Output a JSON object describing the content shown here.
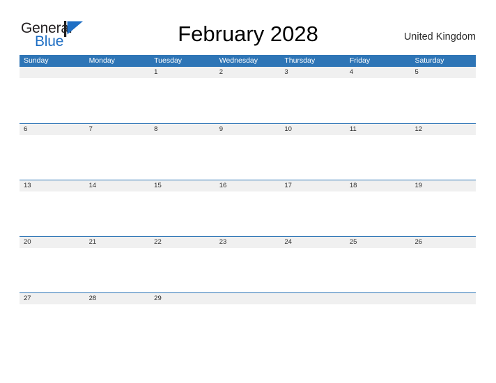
{
  "header": {
    "logo": {
      "word_one": "General",
      "word_two": "Blue",
      "flag_icon": "blue-triangle-flag-icon",
      "word_one_color": "#231f20",
      "word_two_color": "#1f6fc4",
      "flag_color": "#1f6fc4"
    },
    "title": "February 2028",
    "country": "United Kingdom"
  },
  "theme": {
    "header_blue": "#2e75b6",
    "rule_blue": "#2e75b6",
    "date_band_gray": "#f0f0f0",
    "cell_white": "#ffffff",
    "text_dark": "#2b2b2b",
    "title_black": "#000000"
  },
  "calendar": {
    "month": "February",
    "year": "2028",
    "weekdays": [
      "Sunday",
      "Monday",
      "Tuesday",
      "Wednesday",
      "Thursday",
      "Friday",
      "Saturday"
    ],
    "weeks": [
      {
        "days": [
          {
            "date": ""
          },
          {
            "date": ""
          },
          {
            "date": "1"
          },
          {
            "date": "2"
          },
          {
            "date": "3"
          },
          {
            "date": "4"
          },
          {
            "date": "5"
          }
        ]
      },
      {
        "days": [
          {
            "date": "6"
          },
          {
            "date": "7"
          },
          {
            "date": "8"
          },
          {
            "date": "9"
          },
          {
            "date": "10"
          },
          {
            "date": "11"
          },
          {
            "date": "12"
          }
        ]
      },
      {
        "days": [
          {
            "date": "13"
          },
          {
            "date": "14"
          },
          {
            "date": "15"
          },
          {
            "date": "16"
          },
          {
            "date": "17"
          },
          {
            "date": "18"
          },
          {
            "date": "19"
          }
        ]
      },
      {
        "days": [
          {
            "date": "20"
          },
          {
            "date": "21"
          },
          {
            "date": "22"
          },
          {
            "date": "23"
          },
          {
            "date": "24"
          },
          {
            "date": "25"
          },
          {
            "date": "26"
          }
        ]
      },
      {
        "days": [
          {
            "date": "27"
          },
          {
            "date": "28"
          },
          {
            "date": "29"
          },
          {
            "date": ""
          },
          {
            "date": ""
          },
          {
            "date": ""
          },
          {
            "date": ""
          }
        ]
      }
    ]
  }
}
